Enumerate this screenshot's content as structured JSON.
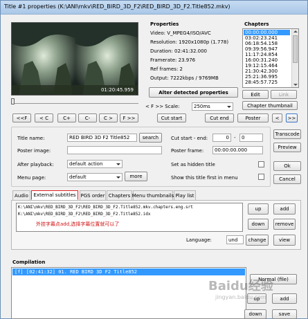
{
  "window": {
    "title": "Title #1 properties (K:\\ANI\\mkv\\RED_BIRD_3D_F2\\RED_BIRD_3D_F2.Title852.mkv)"
  },
  "video": {
    "timecode": "01:20:45.959"
  },
  "properties": {
    "heading": "Properties",
    "lines": [
      "Video: V_MPEG4/ISO/AVC",
      "Resolution: 1920x1080p (1.778)",
      "Duration: 02:41:32.000",
      "Framerate: 23.976",
      "Ref frames: 2",
      "Output: 7222kbps / 9769MB"
    ],
    "alter_button": "Alter detected properties"
  },
  "chapters": {
    "heading": "Chapters",
    "items": [
      "00:00:00.000",
      "03:02:23.241",
      "06:18:54.158",
      "09:39:56.947",
      "11:17:24.854",
      "16:00:31.240",
      "19:12:15.464",
      "21:30:42.300",
      "25:21:36.995",
      "28:45:57.725"
    ],
    "selected_index": 0,
    "edit_button": "Edit",
    "link_button": "Link",
    "thumbnail_button": "Chapter thumbnail"
  },
  "transport": {
    "buttons": [
      "<<F",
      "< C",
      "C+",
      "C-",
      "C >",
      "F >>"
    ],
    "scale_label": "< F >> Scale:",
    "scale_value": "250ms",
    "cut_start": "Cut start",
    "cut_end": "Cut end",
    "poster": "Poster",
    "prev_nav": "<",
    "next_nav": ">>"
  },
  "form": {
    "title_name_label": "Title name:",
    "title_name_value": "RED BIRD 3D F2 Title852",
    "search_button": "search",
    "poster_image_label": "Poster image:",
    "poster_image_value": "",
    "after_playback_label": "After playback:",
    "after_playback_value": "default action",
    "menu_page_label": "Menu page:",
    "menu_page_value": "default",
    "more_button": "more",
    "cut_range_label": "Cut start - end:",
    "cut_start_value": "0",
    "cut_dash": "-",
    "cut_end_value": "0",
    "poster_frame_label": "Poster frame:",
    "poster_frame_value": "00:00:00.000",
    "hidden_title_label": "Set as hidden title",
    "show_first_label": "Show this title first in menu"
  },
  "side_buttons": {
    "transcode": "Transcode",
    "preview": "Preview",
    "ok": "Ok",
    "cancel": "Cancel"
  },
  "tabs": {
    "items": [
      "Audio",
      "External subtitles",
      "PGS order",
      "Chapters",
      "Menu thumbnails",
      "Play list"
    ],
    "active_index": 1
  },
  "subtitles": {
    "files": [
      "K:\\ANI\\mkv\\RED_BIRD_3D_F2\\RED_BIRD_3D_F2.Title852.mkv.chapters.eng.srt",
      "K:\\ANI\\mkv\\RED_BIRD_3D_F2\\RED_BIRD_3D_F2.Title852.idx"
    ],
    "note": "外挂字幕点add,选择字幕位置就可以了",
    "up": "up",
    "add": "add",
    "down": "down",
    "remove": "remove",
    "language_label": "Language:",
    "language_value": "und",
    "change": "change",
    "view": "view"
  },
  "compilation": {
    "heading": "Compilation",
    "items": [
      "[f] [02:41:32] 01. RED BIRD 3D F2 Title852"
    ],
    "normal_file": "Normal (file)",
    "up": "up",
    "add": "add",
    "down": "down",
    "save": "save"
  },
  "watermark": {
    "text": "Baidu经验",
    "url": "jingyan.baidu.com"
  },
  "colors": {
    "accent_red": "#e02020",
    "note_red": "#d01010",
    "selection_blue": "#3399ff",
    "compilation_bg": "#ffffff",
    "window_bg": "#f0f0f0"
  }
}
